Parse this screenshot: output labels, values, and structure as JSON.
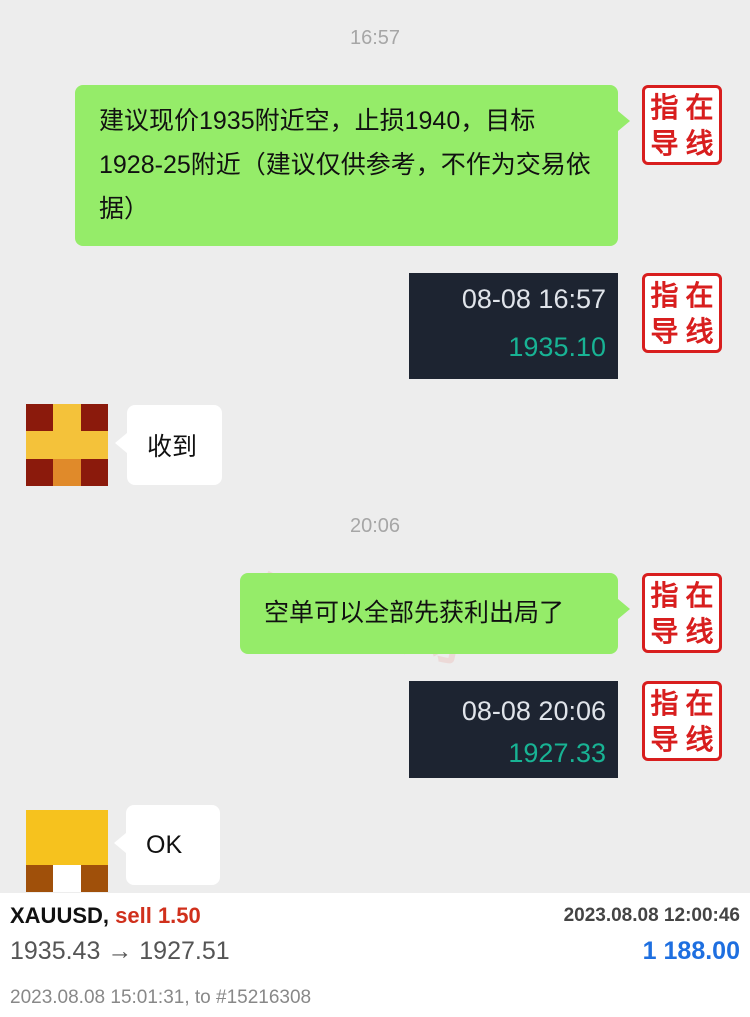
{
  "messages": {
    "time1": "16:57",
    "msg1": "建议现价1935附近空，止损1940，目标1928-25附近（建议仅供参考，不作为交易依据）",
    "card1": {
      "time": "08-08 16:57",
      "price": "1935.10"
    },
    "reply1": "收到",
    "time2": "20:06",
    "msg2": "空单可以全部先获利出局了",
    "card2": {
      "time": "08-08 20:06",
      "price": "1927.33"
    },
    "reply2": "OK"
  },
  "seal": {
    "chars": [
      "指",
      "在",
      "导",
      "线"
    ],
    "color": "#d81e1e"
  },
  "watermark": "在线指导",
  "trade": {
    "symbol": "XAUUSD,",
    "side": "sell 1.50",
    "close_time": "2023.08.08 12:00:46",
    "prices": "1935.43 → 1927.51",
    "profit": "1 188.00",
    "detail": "2023.08.08 15:01:31, to #15216308"
  },
  "colors": {
    "bubble_out": "#95ec69",
    "profit": "#1e6fe0",
    "sell": "#d0301c"
  }
}
